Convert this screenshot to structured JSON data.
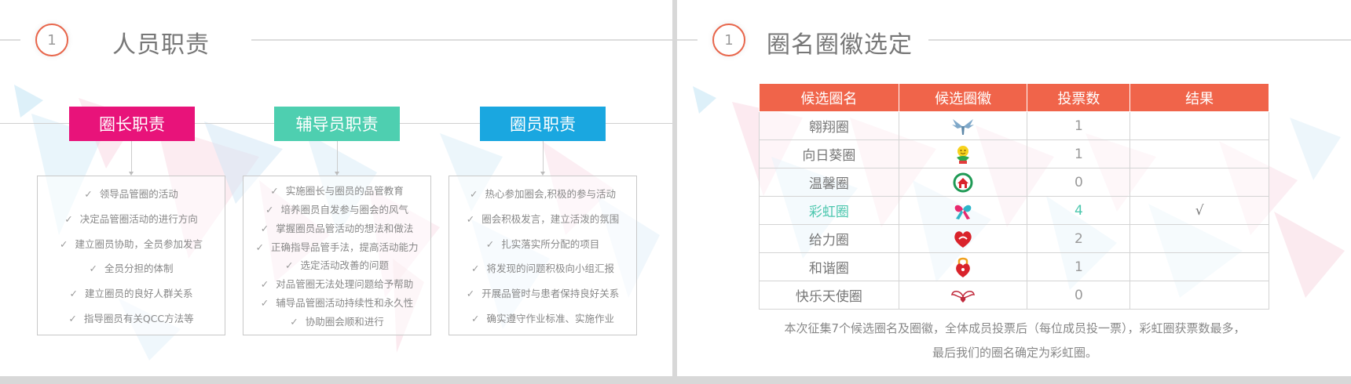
{
  "left_slide": {
    "number": "1",
    "title": "人员职责",
    "roles": [
      {
        "title": "圈长职责",
        "color": "#e8137a",
        "items": [
          "领导品管圈的活动",
          "决定品管圈活动的进行方向",
          "建立圈员协助，全员参加发言",
          "全员分担的体制",
          "建立圈员的良好人群关系",
          "指导圈员有关QCC方法等"
        ]
      },
      {
        "title": "辅导员职责",
        "color": "#4ecfb0",
        "items": [
          "实施圈长与圈员的品管教育",
          "培养圈员自发参与圈会的风气",
          "掌握圈员品管活动的想法和做法",
          "正确指导品管手法，提高活动能力",
          "选定活动改善的问题",
          "对品管圈无法处理问题给予帮助",
          "辅导品管圈活动持续性和永久性",
          "协助圈会顺和进行"
        ]
      },
      {
        "title": "圈员职责",
        "color": "#1aa7e0",
        "items": [
          "热心参加圈会,积极的参与活动",
          "圈会积极发言，建立活泼的氛围",
          "扎实落实所分配的项目",
          "将发现的问题积极向小组汇报",
          "开展品管时与患者保持良好关系",
          "确实遵守作业标准、实施作业"
        ]
      }
    ]
  },
  "right_slide": {
    "number": "1",
    "title": "圈名圈徽选定",
    "table": {
      "headers": [
        "候选圈名",
        "候选圈徽",
        "投票数",
        "结果"
      ],
      "header_color": "#f0644a",
      "rows": [
        {
          "name": "翱翔圈",
          "emblem": "bird-wings-icon",
          "votes": "1",
          "result": "",
          "winner": false
        },
        {
          "name": "向日葵圈",
          "emblem": "sunflower-icon",
          "votes": "1",
          "result": "",
          "winner": false
        },
        {
          "name": "温馨圈",
          "emblem": "house-icon",
          "votes": "0",
          "result": "",
          "winner": false
        },
        {
          "name": "彩虹圈",
          "emblem": "ribbon-heart-icon",
          "votes": "4",
          "result": "√",
          "winner": true
        },
        {
          "name": "给力圈",
          "emblem": "heart-icon",
          "votes": "2",
          "result": "",
          "winner": false
        },
        {
          "name": "和谐圈",
          "emblem": "lock-heart-icon",
          "votes": "1",
          "result": "",
          "winner": false
        },
        {
          "name": "快乐天使圈",
          "emblem": "angel-wings-icon",
          "votes": "0",
          "result": "",
          "winner": false
        }
      ]
    },
    "caption_lines": [
      "本次征集7个候选圈名及圈徽，全体成员投票后（每位成员投一票），彩虹圈获票数最多，",
      "最后我们的圈名确定为彩虹圈。"
    ],
    "winner_color": "#4dc7ae"
  }
}
